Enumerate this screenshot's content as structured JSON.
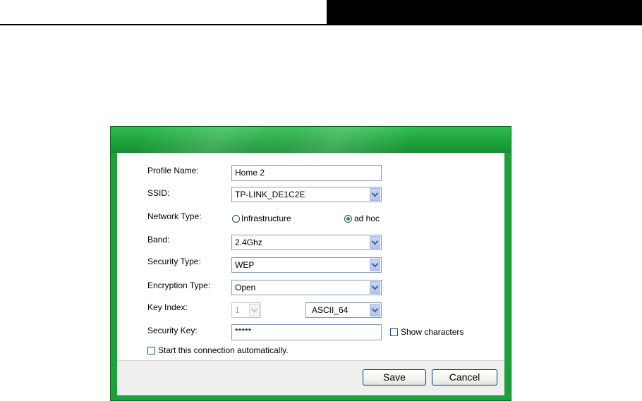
{
  "dialog": {
    "labels": {
      "profile_name": "Profile Name:",
      "ssid": "SSID:",
      "network_type": "Network Type:",
      "band": "Band:",
      "security_type": "Security Type:",
      "encryption_type": "Encryption Type:",
      "key_index": "Key Index:",
      "security_key": "Security Key:"
    },
    "values": {
      "profile_name": "Home 2",
      "ssid": "TP-LINK_DE1C2E",
      "band": "2.4Ghz",
      "security_type": "WEP",
      "encryption_type": "Open",
      "key_index": "1",
      "key_format": "ASCII_64",
      "security_key": "*****"
    },
    "network_type": {
      "options": [
        "Infrastructure",
        "ad hoc"
      ],
      "selected": "ad hoc"
    },
    "show_characters": {
      "label": "Show characters",
      "checked": false
    },
    "auto_connect": {
      "label": "Start this connection automatically.",
      "checked": false
    },
    "buttons": {
      "save": "Save",
      "cancel": "Cancel"
    },
    "colors": {
      "frame": "#1ea13a",
      "radio_dot": "#21a121",
      "control_border": "#7f9db9"
    }
  }
}
